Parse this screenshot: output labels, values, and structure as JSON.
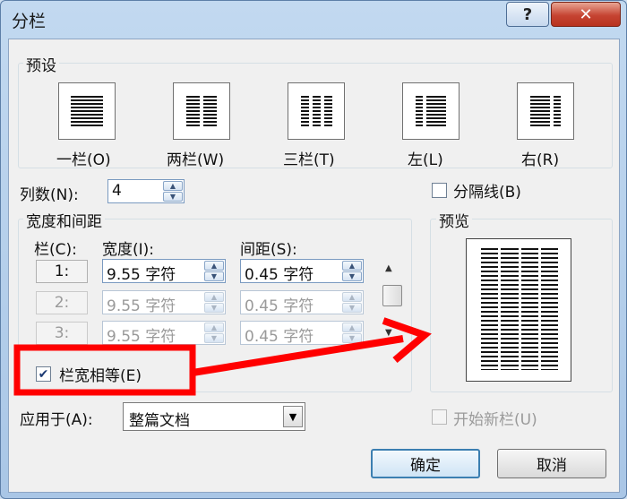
{
  "window": {
    "title": "分栏",
    "help_label": "?",
    "close_label": "✕"
  },
  "presets": {
    "group_label": "预设",
    "items": [
      {
        "label": "一栏(O)"
      },
      {
        "label": "两栏(W)"
      },
      {
        "label": "三栏(T)"
      },
      {
        "label": "左(L)"
      },
      {
        "label": "右(R)"
      }
    ]
  },
  "columns": {
    "label": "列数(N):",
    "value": "4"
  },
  "separator": {
    "label": "分隔线(B)",
    "checked": false
  },
  "width_spacing": {
    "group_label": "宽度和间距",
    "col_header": "栏(C):",
    "width_header": "宽度(I):",
    "spacing_header": "间距(S):",
    "rows": [
      {
        "num": "1:",
        "width": "9.55 字符",
        "spacing": "0.45 字符",
        "enabled": true
      },
      {
        "num": "2:",
        "width": "9.55 字符",
        "spacing": "0.45 字符",
        "enabled": false
      },
      {
        "num": "3:",
        "width": "9.55 字符",
        "spacing": "0.45 字符",
        "enabled": false
      }
    ]
  },
  "equal_width": {
    "label": "栏宽相等(E)",
    "checked": true
  },
  "apply_to": {
    "label": "应用于(A):",
    "value": "整篇文档"
  },
  "preview": {
    "group_label": "预览"
  },
  "new_column": {
    "label": "开始新栏(U)",
    "checked": false
  },
  "buttons": {
    "ok": "确定",
    "cancel": "取消"
  },
  "colors": {
    "annotation": "#ff0000",
    "accent": "#3c7fb1"
  }
}
